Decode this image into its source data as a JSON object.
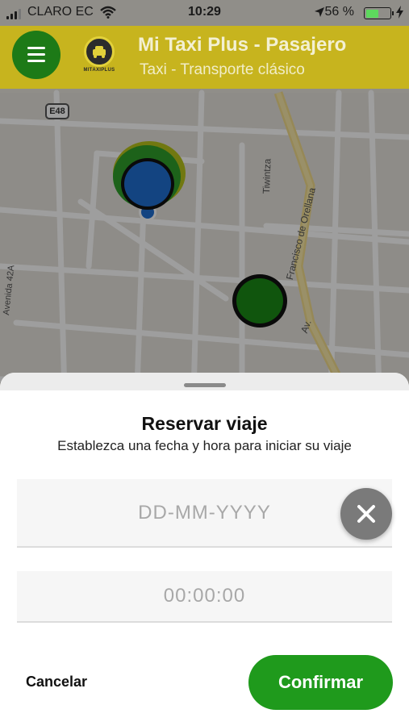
{
  "status_bar": {
    "carrier": "CLARO EC",
    "time": "10:29",
    "battery_percent": "56 %",
    "battery_level": 0.56,
    "icons": [
      "signal-icon",
      "wifi-icon",
      "location-arrow-icon",
      "battery-icon",
      "charging-bolt-icon"
    ]
  },
  "header": {
    "title": "Mi Taxi Plus - Pasajero",
    "subtitle": "Taxi - Transporte clásico",
    "logo_text": "MITAXIPLUS",
    "menu_icon": "hamburger-menu-icon"
  },
  "map": {
    "road_shield": "E48",
    "street_labels": [
      "Tiwintza",
      "Francisco de Orellana",
      "Av.",
      "Avenida 42A"
    ]
  },
  "reservation": {
    "title": "Reservar viaje",
    "subtitle": "Establezca una fecha y hora para iniciar su viaje",
    "date_placeholder": "DD-MM-YYYY",
    "time_value": "00:00:00",
    "clear_icon": "close-icon",
    "cancel_label": "Cancelar",
    "confirm_label": "Confirmar"
  },
  "colors": {
    "header_bg": "#c7b41e",
    "accent_green": "#1f9a1c",
    "marker_blue": "#1f6fd1"
  }
}
